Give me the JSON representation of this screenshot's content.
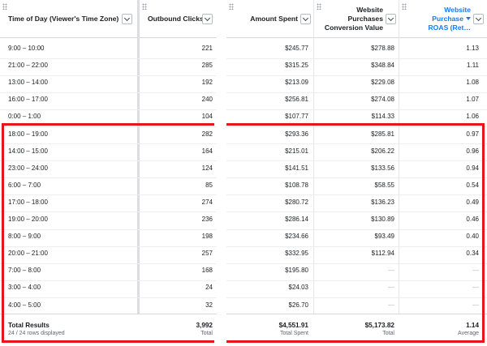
{
  "left": {
    "headers": {
      "time_of_day": "Time of Day (Viewer's Time Zone)",
      "outbound_clicks": "Outbound Clicks"
    }
  },
  "right": {
    "headers": {
      "amount_spent": "Amount Spent",
      "conv_value_line1": "Website",
      "conv_value_line2": "Purchases",
      "conv_value_line3": "Conversion Value",
      "roas_line1": "Website",
      "roas_line2": "Purchase",
      "roas_line3": "ROAS (Ret…"
    }
  },
  "rows": [
    {
      "time": "9:00 – 10:00",
      "clicks": "221",
      "spent": "$245.77",
      "value": "$278.88",
      "roas": "1.13"
    },
    {
      "time": "21:00 – 22:00",
      "clicks": "285",
      "spent": "$315.25",
      "value": "$348.84",
      "roas": "1.11"
    },
    {
      "time": "13:00 – 14:00",
      "clicks": "192",
      "spent": "$213.09",
      "value": "$229.08",
      "roas": "1.08"
    },
    {
      "time": "16:00 – 17:00",
      "clicks": "240",
      "spent": "$256.81",
      "value": "$274.08",
      "roas": "1.07"
    },
    {
      "time": "0:00 – 1:00",
      "clicks": "104",
      "spent": "$107.77",
      "value": "$114.33",
      "roas": "1.06"
    },
    {
      "time": "18:00 – 19:00",
      "clicks": "282",
      "spent": "$293.36",
      "value": "$285.81",
      "roas": "0.97"
    },
    {
      "time": "14:00 – 15:00",
      "clicks": "164",
      "spent": "$215.01",
      "value": "$206.22",
      "roas": "0.96"
    },
    {
      "time": "23:00 – 24:00",
      "clicks": "124",
      "spent": "$141.51",
      "value": "$133.56",
      "roas": "0.94"
    },
    {
      "time": "6:00 – 7:00",
      "clicks": "85",
      "spent": "$108.78",
      "value": "$58.55",
      "roas": "0.54"
    },
    {
      "time": "17:00 – 18:00",
      "clicks": "274",
      "spent": "$280.72",
      "value": "$136.23",
      "roas": "0.49"
    },
    {
      "time": "19:00 – 20:00",
      "clicks": "236",
      "spent": "$286.14",
      "value": "$130.89",
      "roas": "0.46"
    },
    {
      "time": "8:00 – 9:00",
      "clicks": "198",
      "spent": "$234.66",
      "value": "$93.49",
      "roas": "0.40"
    },
    {
      "time": "20:00 – 21:00",
      "clicks": "257",
      "spent": "$332.95",
      "value": "$112.94",
      "roas": "0.34"
    },
    {
      "time": "7:00 – 8:00",
      "clicks": "168",
      "spent": "$195.80",
      "value": "—",
      "roas": "—"
    },
    {
      "time": "3:00 – 4:00",
      "clicks": "24",
      "spent": "$24.03",
      "value": "—",
      "roas": "—"
    },
    {
      "time": "4:00 – 5:00",
      "clicks": "32",
      "spent": "$26.70",
      "value": "—",
      "roas": "—"
    }
  ],
  "footer": {
    "total_results": "Total Results",
    "rows_displayed": "24 / 24 rows displayed",
    "clicks_total": "3,992",
    "clicks_label": "Total",
    "spent_total": "$4,551.91",
    "spent_label": "Total Spent",
    "value_total": "$5,173.82",
    "value_label": "Total",
    "roas_total": "1.14",
    "roas_label": "Average"
  },
  "colors": {
    "highlight": "#e8141b",
    "sort_blue": "#1877f2"
  },
  "icons": {
    "column_grip": "drag-dots-icon",
    "column_menu": "chevron-down-icon",
    "sort": "sort-descending-icon"
  }
}
